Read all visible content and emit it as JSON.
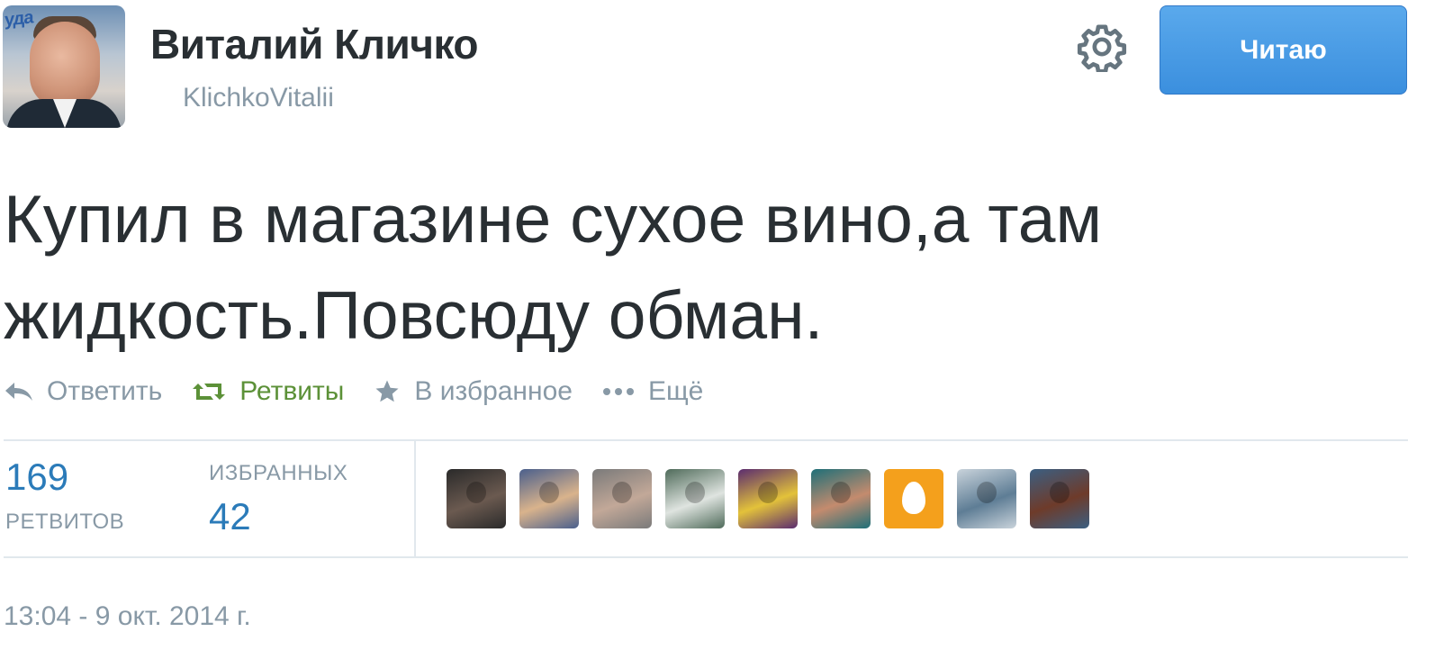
{
  "header": {
    "name": "Виталий Кличко",
    "handle": "KlichkoVitalii",
    "follow_label": "Читаю",
    "avatar_sign": "уда"
  },
  "tweet": {
    "line1": "Купил в магазине сухое вино,а там",
    "line2": "жидкость.Повсюду обман."
  },
  "actions": {
    "reply": "Ответить",
    "retweet": "Ретвиты",
    "favorite": "В избранное",
    "more": "Ещё"
  },
  "stats": {
    "retweets_count": "169",
    "retweets_label": "РЕТВИТОВ",
    "favorites_label": "ИЗБРАННЫХ",
    "favorites_count": "42"
  },
  "favoriters": [
    {
      "icon": "user-avatar-photo-1",
      "colors": [
        "#2a2a2a",
        "#6b5a50"
      ]
    },
    {
      "icon": "user-avatar-photo-2",
      "colors": [
        "#4a5f8c",
        "#d9b38c"
      ]
    },
    {
      "icon": "user-avatar-photo-3",
      "colors": [
        "#7a7a7a",
        "#c2a898"
      ]
    },
    {
      "icon": "user-avatar-photo-4",
      "colors": [
        "#4f6b5a",
        "#dfe4e0"
      ]
    },
    {
      "icon": "user-avatar-photo-5",
      "colors": [
        "#5b2c6f",
        "#e3c23a"
      ]
    },
    {
      "icon": "user-avatar-photo-6",
      "colors": [
        "#1e6f78",
        "#c48b6e"
      ]
    },
    {
      "icon": "user-avatar-default-egg",
      "colors": [
        "#f4a01c",
        "#ffffff"
      ]
    },
    {
      "icon": "user-avatar-photo-8",
      "colors": [
        "#c9d3db",
        "#5e7d95"
      ]
    },
    {
      "icon": "user-avatar-photo-9",
      "colors": [
        "#3b5f82",
        "#6e3b2a"
      ]
    }
  ],
  "timestamp": "13:04 - 9 окт. 2014 г.",
  "colors": {
    "link_blue": "#2b7bb9",
    "muted": "#8899a6",
    "retweet_green": "#5c9138",
    "follow_button": "#4a9ee6"
  }
}
